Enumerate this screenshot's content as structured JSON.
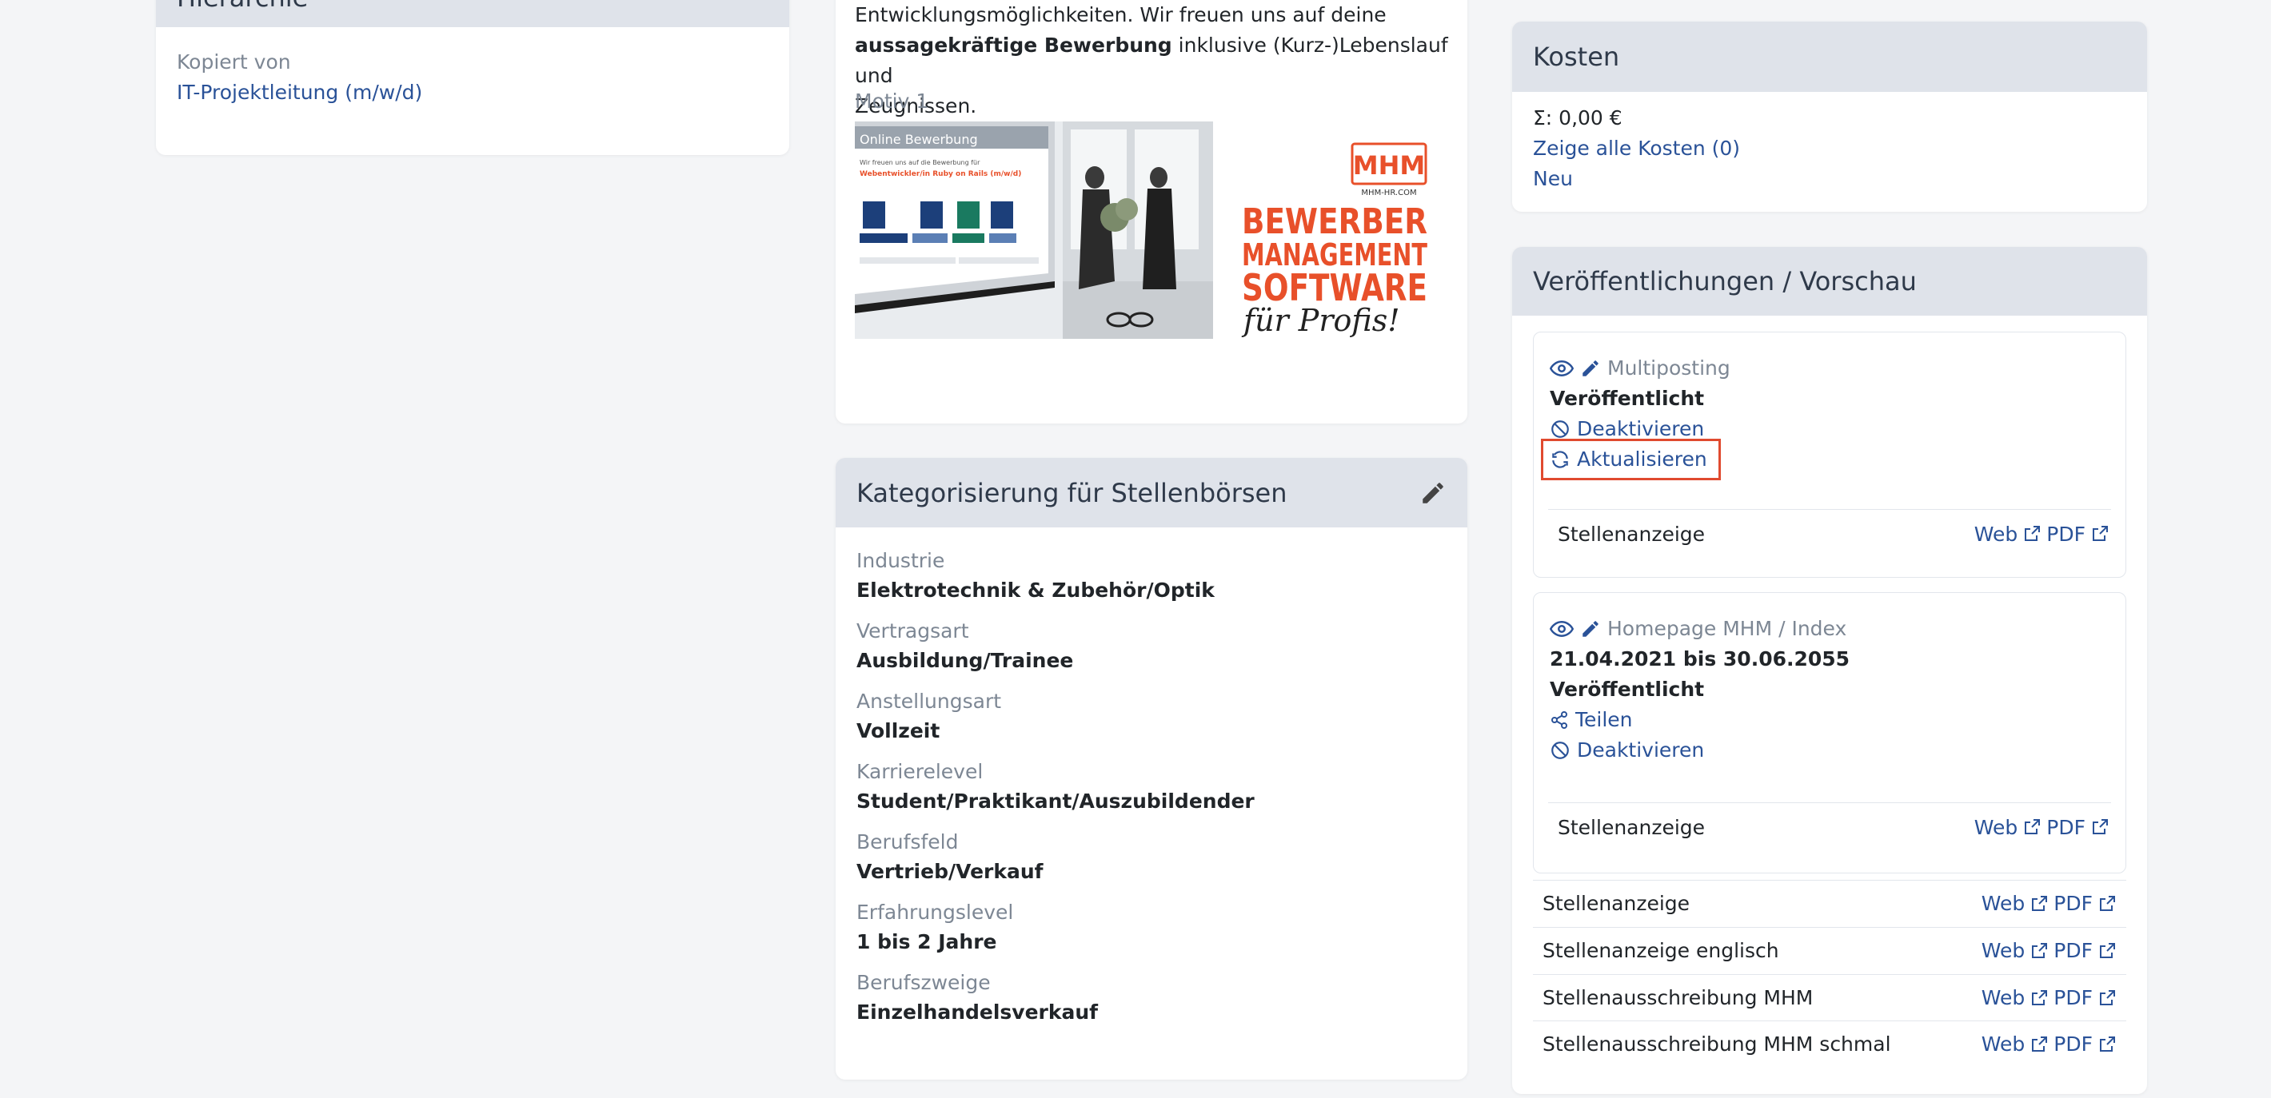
{
  "left_card": {
    "header": "Hierarchie",
    "copied_from_label": "Kopiert von",
    "copied_from_link": "IT-Projektleitung (m/w/d)"
  },
  "description_card": {
    "text_line1": "Entwicklungsmöglichkeiten. Wir freuen uns auf deine",
    "text_line2_bold": "aussagekräftige Bewerbung",
    "text_line2_rest": " inklusive (Kurz-)Lebenslauf und",
    "text_line3": "Zeugnissen.",
    "motiv_label": "Motiv 1",
    "banner": {
      "screen_title": "Online Bewerbung",
      "screen_sub": "Wir freuen uns auf die Bewerbung für",
      "screen_job": "Webentwickler/in Ruby on Rails (m/w/d)",
      "logo_text": "MHM",
      "logo_domain": "MHM-HR.COM",
      "line1": "BEWERBER",
      "line2": "MANAGEMENT",
      "line3": "SOFTWARE",
      "line4": "für Profis!"
    }
  },
  "category_card": {
    "header": "Kategorisierung für Stellenbörsen",
    "items": [
      {
        "label": "Industrie",
        "value": "Elektrotechnik & Zubehör/Optik"
      },
      {
        "label": "Vertragsart",
        "value": "Ausbildung/Trainee"
      },
      {
        "label": "Anstellungsart",
        "value": "Vollzeit"
      },
      {
        "label": "Karrierelevel",
        "value": "Student/Praktikant/Auszubildender"
      },
      {
        "label": "Berufsfeld",
        "value": "Vertrieb/Verkauf"
      },
      {
        "label": "Erfahrungslevel",
        "value": "1 bis 2 Jahre"
      },
      {
        "label": "Berufszweige",
        "value": "Einzelhandelsverkauf"
      }
    ]
  },
  "costs_card": {
    "header": "Kosten",
    "sum": "Σ: 0,00 €",
    "show_all": "Zeige alle Kosten (0)",
    "new": "Neu"
  },
  "publications_card": {
    "header": "Veröffentlichungen / Vorschau",
    "multiposting": {
      "title": "Multiposting",
      "status": "Veröffentlicht",
      "deactivate": "Deaktivieren",
      "update": "Aktualisieren",
      "row_label": "Stellenanzeige",
      "web": "Web",
      "pdf": "PDF"
    },
    "homepage": {
      "title": "Homepage MHM / Index",
      "dates": "21.04.2021 bis 30.06.2055",
      "status": "Veröffentlicht",
      "share": "Teilen",
      "deactivate": "Deaktivieren",
      "row_label": "Stellenanzeige",
      "web": "Web",
      "pdf": "PDF"
    },
    "list": [
      {
        "label": "Stellenanzeige",
        "web": "Web",
        "pdf": "PDF"
      },
      {
        "label": "Stellenanzeige englisch",
        "web": "Web",
        "pdf": "PDF"
      },
      {
        "label": "Stellenausschreibung MHM",
        "web": "Web",
        "pdf": "PDF"
      },
      {
        "label": "Stellenausschreibung MHM schmal",
        "web": "Web",
        "pdf": "PDF"
      }
    ]
  },
  "colors": {
    "link": "#2a5298",
    "header_bg": "#dfe3ea",
    "highlight": "#e04a2f",
    "brand_orange": "#e8502a"
  }
}
